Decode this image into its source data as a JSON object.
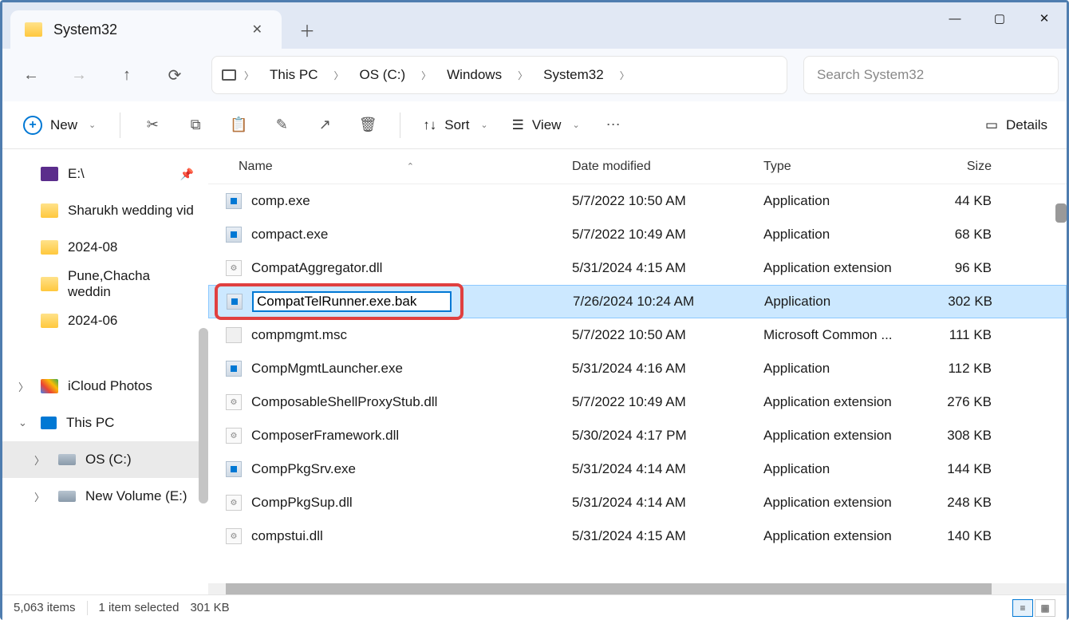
{
  "tab": {
    "title": "System32"
  },
  "breadcrumb": [
    "This PC",
    "OS (C:)",
    "Windows",
    "System32"
  ],
  "search": {
    "placeholder": "Search System32"
  },
  "toolbar": {
    "new_label": "New",
    "sort_label": "Sort",
    "view_label": "View",
    "details_label": "Details"
  },
  "sidebar": {
    "items": [
      {
        "label": "E:\\",
        "icon": "video",
        "pinned": true
      },
      {
        "label": "Sharukh wedding vid",
        "icon": "folder"
      },
      {
        "label": "2024-08",
        "icon": "folder"
      },
      {
        "label": "Pune,Chacha weddin",
        "icon": "folder"
      },
      {
        "label": "2024-06",
        "icon": "folder"
      },
      {
        "label": "iCloud Photos",
        "icon": "cloud",
        "expandable": true
      },
      {
        "label": "This PC",
        "icon": "pc",
        "expanded": true
      },
      {
        "label": "OS (C:)",
        "icon": "drive",
        "sub": true,
        "selected": true,
        "expandable": true
      },
      {
        "label": "New Volume (E:)",
        "icon": "drive",
        "sub": true,
        "expandable": true
      }
    ]
  },
  "columns": {
    "name": "Name",
    "date": "Date modified",
    "type": "Type",
    "size": "Size"
  },
  "files": [
    {
      "name": "comp.exe",
      "date": "5/7/2022 10:50 AM",
      "type": "Application",
      "size": "44 KB",
      "ico": "exe"
    },
    {
      "name": "compact.exe",
      "date": "5/7/2022 10:49 AM",
      "type": "Application",
      "size": "68 KB",
      "ico": "exe"
    },
    {
      "name": "CompatAggregator.dll",
      "date": "5/31/2024 4:15 AM",
      "type": "Application extension",
      "size": "96 KB",
      "ico": "dll"
    },
    {
      "name": "CompatTelRunner.exe.bak",
      "date": "7/26/2024 10:24 AM",
      "type": "Application",
      "size": "302 KB",
      "ico": "exe",
      "selected": true,
      "renaming": true
    },
    {
      "name": "compmgmt.msc",
      "date": "5/7/2022 10:50 AM",
      "type": "Microsoft Common ...",
      "size": "111 KB",
      "ico": "msc"
    },
    {
      "name": "CompMgmtLauncher.exe",
      "date": "5/31/2024 4:16 AM",
      "type": "Application",
      "size": "112 KB",
      "ico": "exe"
    },
    {
      "name": "ComposableShellProxyStub.dll",
      "date": "5/7/2022 10:49 AM",
      "type": "Application extension",
      "size": "276 KB",
      "ico": "dll"
    },
    {
      "name": "ComposerFramework.dll",
      "date": "5/30/2024 4:17 PM",
      "type": "Application extension",
      "size": "308 KB",
      "ico": "dll"
    },
    {
      "name": "CompPkgSrv.exe",
      "date": "5/31/2024 4:14 AM",
      "type": "Application",
      "size": "144 KB",
      "ico": "exe"
    },
    {
      "name": "CompPkgSup.dll",
      "date": "5/31/2024 4:14 AM",
      "type": "Application extension",
      "size": "248 KB",
      "ico": "dll"
    },
    {
      "name": "compstui.dll",
      "date": "5/31/2024 4:15 AM",
      "type": "Application extension",
      "size": "140 KB",
      "ico": "dll"
    }
  ],
  "statusbar": {
    "item_count": "5,063 items",
    "selection": "1 item selected",
    "sel_size": "301 KB"
  }
}
